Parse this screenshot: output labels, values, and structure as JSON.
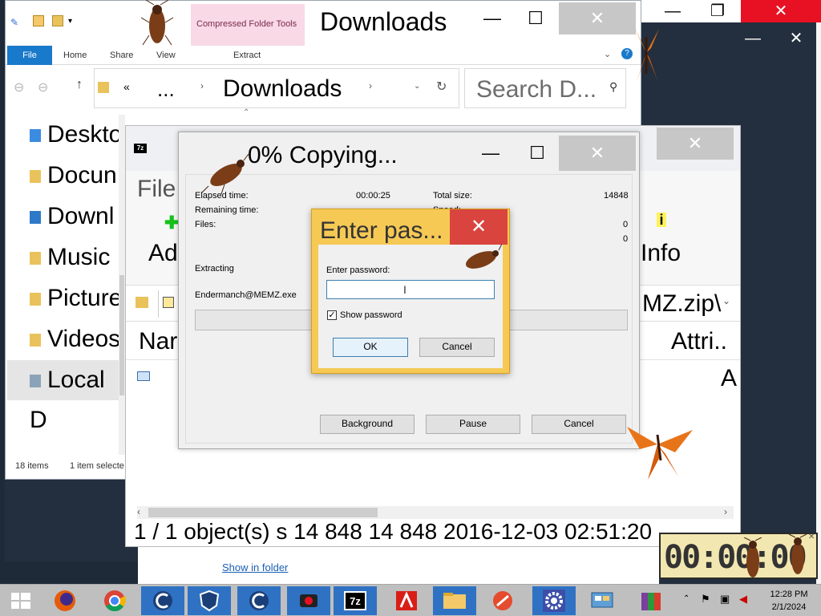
{
  "explorer": {
    "ribbon_context": "Compressed Folder Tools",
    "title": "Downloads",
    "tabs": {
      "file": "File",
      "home": "Home",
      "share": "Share",
      "view": "View",
      "extract": "Extract"
    },
    "address": {
      "ellipsis": "...",
      "prev_chevron": "«",
      "current": "Downloads"
    },
    "search_placeholder": "Search D...",
    "nav_items": [
      "Deskto",
      "Docun",
      "Downl",
      "Music",
      "Picture",
      "Videos",
      "Local D"
    ],
    "status": {
      "items": "18 items",
      "selected": "1 item selecte"
    }
  },
  "sevenzip": {
    "menu_file": "File",
    "toolbar_add": "Ad",
    "toolbar_info": "Info",
    "path_tail": "MZ.zip\\",
    "col_name": "Nar",
    "col_attrib": "Attri..",
    "row_attrib": "A",
    "status": "1 / 1 object(s) s 14 848 14 848 2016-12-03 02:51:20"
  },
  "copying": {
    "title": "0% Copying...",
    "elapsed_label": "Elapsed time:",
    "elapsed_value": "00:00:25",
    "remaining_label": "Remaining time:",
    "files_label": "Files:",
    "total_label": "Total size:",
    "total_value": "14848",
    "speed_label": "Speed:",
    "right_val1": "0",
    "right_val2": "0",
    "extracting_label": "Extracting",
    "file_name": "Endermanch@MEMZ.exe",
    "progress": 0,
    "buttons": {
      "background": "Background",
      "pause": "Pause",
      "cancel": "Cancel"
    }
  },
  "password": {
    "title": "Enter pas...",
    "label": "Enter password:",
    "value": "",
    "show_password_label": "Show password",
    "show_password_checked": true,
    "ok": "OK",
    "cancel": "Cancel"
  },
  "background": {
    "show_in_folder": "Show in folder"
  },
  "timer": "00:00:00",
  "taskbar": {
    "time": "12:28 PM",
    "date": "2/1/2024",
    "apps": [
      "firefox",
      "chrome",
      "ccleaner-c1",
      "shield-vpn",
      "ccleaner-c2",
      "screen-recorder",
      "7zip",
      "avira",
      "file-explorer",
      "ccleaner-broom",
      "settings-gear",
      "control-panel",
      "winrar"
    ]
  },
  "colors": {
    "explorer_file_tab": "#1979ca",
    "context_tab": "#f9d9e6",
    "password_frame": "#f6c955",
    "password_close": "#d9443f",
    "taskbar": "#bfbfbf"
  }
}
